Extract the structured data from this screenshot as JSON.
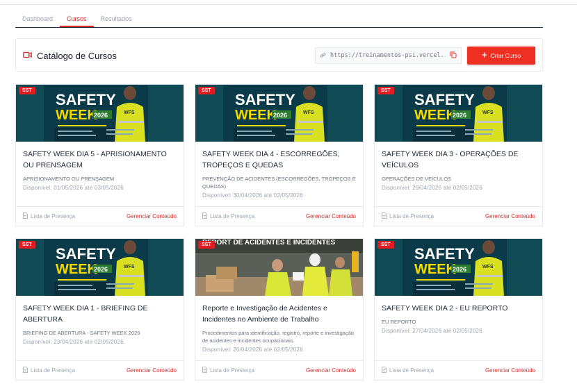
{
  "tabs": [
    "Dashboard",
    "Cursos",
    "Resultados"
  ],
  "active_tab": 1,
  "header": {
    "title": "Catálogo de Cursos",
    "url": "https://treinamentos-psi.vercel...",
    "create_label": "Criar Curso"
  },
  "thumb_text": {
    "safety": "SAFETY",
    "week": "WEEK",
    "year": "2026",
    "vest": "WFS",
    "report": "REPORT DE ACIDENTES E INCIDENTES"
  },
  "courses": [
    {
      "badge": "SST",
      "title": "SAFETY WEEK DIA 5 - APRISIONAMENTO OU PRENSAGEM",
      "desc": "APRISIONAMENTO OU PRENSAGEM",
      "avail": "Disponível: 01/05/2026 até 03/05/2026",
      "list": "Lista de Presença",
      "manage": "Gerenciar Conteúdo"
    },
    {
      "badge": "SST",
      "title": "SAFETY WEEK DIA 4 - ESCORREGÕES, TROPEÇOS E QUEDAS",
      "desc": "PREVENÇÃO DE ACIDENTES (ESCORREGÕES, TROPEÇOS E QUEDAS)",
      "avail": "Disponível: 30/04/2026 até 02/05/2026",
      "list": "Lista de Presença",
      "manage": "Gerenciar Conteúdo"
    },
    {
      "badge": "SST",
      "title": "SAFETY WEEK DIA 3 - OPERAÇÕES DE VEÍCULOS",
      "desc": "OPERAÇÕES DE VEÍCULOS",
      "avail": "Disponível: 29/04/2026 até 02/05/2026",
      "list": "Lista de Presença",
      "manage": "Gerenciar Conteúdo"
    },
    {
      "badge": "SST",
      "title": "SAFETY WEEK DIA 1 - BRIEFING DE ABERTURA",
      "desc": "BRIEFING DE ABERTURA - SAFETY WEEK 2026",
      "avail": "Disponível: 23/04/2026 até 02/05/2026",
      "list": "Lista de Presença",
      "manage": "Gerenciar Conteúdo"
    },
    {
      "badge": "SST",
      "title": "Reporte e Investigação de Acidentes e Incidentes no Ambiente de Trabalho",
      "desc": "Procedimentos para identificação, registro, reporte e investigação de acidentes e incidentes ocupacionais.",
      "avail": "Disponível: 26/04/2026 até 02/05/2026",
      "list": "Lista de Presença",
      "manage": "Gerenciar Conteúdo"
    },
    {
      "badge": "SST",
      "title": "SAFETY WEEK DIA 2 - EU REPORTO",
      "desc": "EU REPORTO",
      "avail": "Disponível: 27/04/2026 até 02/05/2026",
      "list": "Lista de Presença",
      "manage": "Gerenciar Conteúdo"
    }
  ],
  "colors": {
    "accent": "#ef2f22",
    "thumb_teal": "#0f4a55",
    "thumb_yellow": "#f2d900"
  },
  "icons": [
    "video-icon",
    "link-icon",
    "copy-icon",
    "plus-icon",
    "document-icon"
  ]
}
